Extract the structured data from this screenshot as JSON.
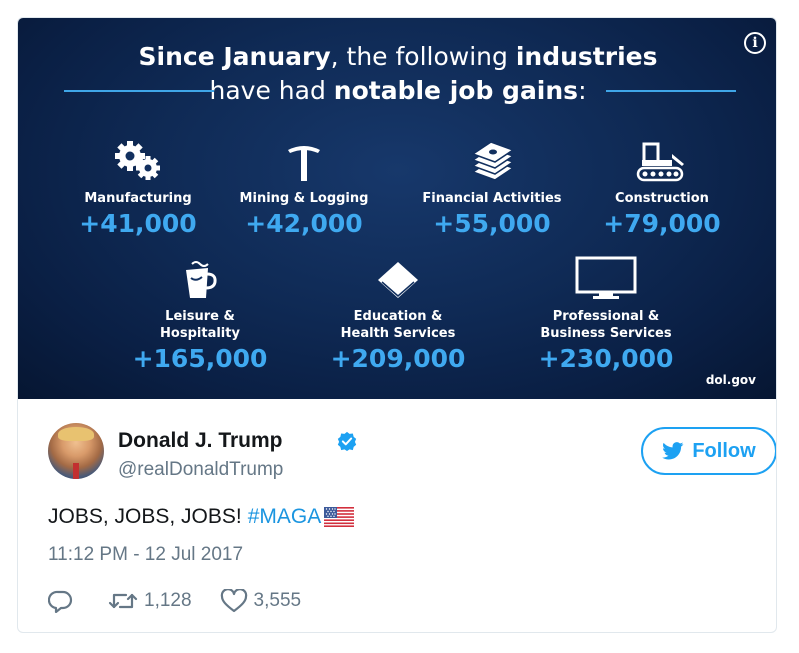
{
  "media": {
    "headline_line1_bold": "Since January",
    "headline_line1_rest": ", the following ",
    "headline_line1_bold2": "industries",
    "headline_line2_rest": "have had ",
    "headline_line2_bold": "notable job gains",
    "headline_line2_end": ":",
    "source": "dol.gov",
    "accent_color": "#3fa9f0",
    "stats": [
      {
        "label": "Manufacturing",
        "value": "+41,000",
        "icon": "gears-icon"
      },
      {
        "label": "Mining & Logging",
        "value": "+42,000",
        "icon": "pickaxe-icon"
      },
      {
        "label": "Financial Activities",
        "value": "+55,000",
        "icon": "money-stack-icon"
      },
      {
        "label": "Construction",
        "value": "+79,000",
        "icon": "bulldozer-icon"
      },
      {
        "label_line1": "Leisure &",
        "label_line2": "Hospitality",
        "value": "+165,000",
        "icon": "coffee-cup-icon"
      },
      {
        "label_line1": "Education &",
        "label_line2": "Health Services",
        "value": "+209,000",
        "icon": "book-icon"
      },
      {
        "label_line1": "Professional &",
        "label_line2": "Business Services",
        "value": "+230,000",
        "icon": "monitor-icon"
      }
    ]
  },
  "tweet": {
    "display_name": "Donald J. Trump",
    "handle": "@realDonaldTrump",
    "follow_label": "Follow",
    "text": "JOBS, JOBS, JOBS!",
    "hashtag": "#MAGA",
    "timestamp": "11:12 PM - 12 Jul 2017",
    "retweets": "1,128",
    "likes": "3,555",
    "brand_color": "#1da1f2"
  }
}
